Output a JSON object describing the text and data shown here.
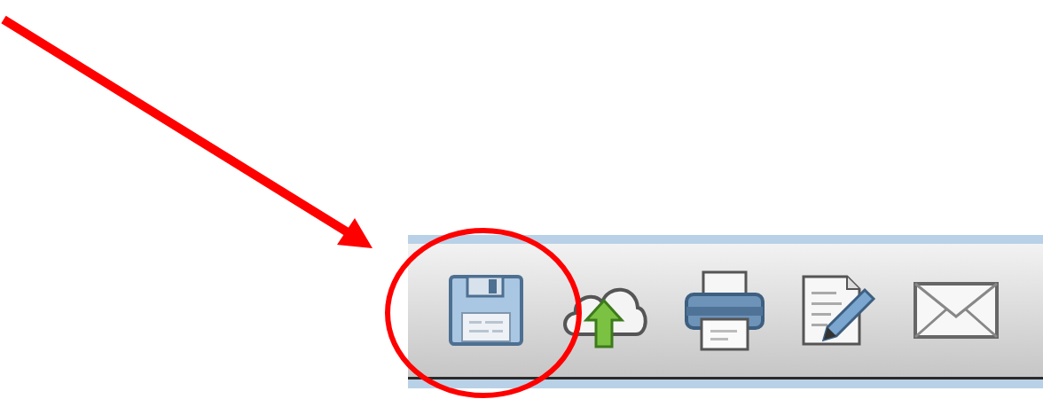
{
  "toolbar": {
    "buttons": [
      {
        "kind": "save"
      },
      {
        "kind": "upload"
      },
      {
        "kind": "print"
      },
      {
        "kind": "edit"
      },
      {
        "kind": "mail"
      }
    ]
  },
  "annotation": {
    "arrow": true,
    "circle": true
  }
}
